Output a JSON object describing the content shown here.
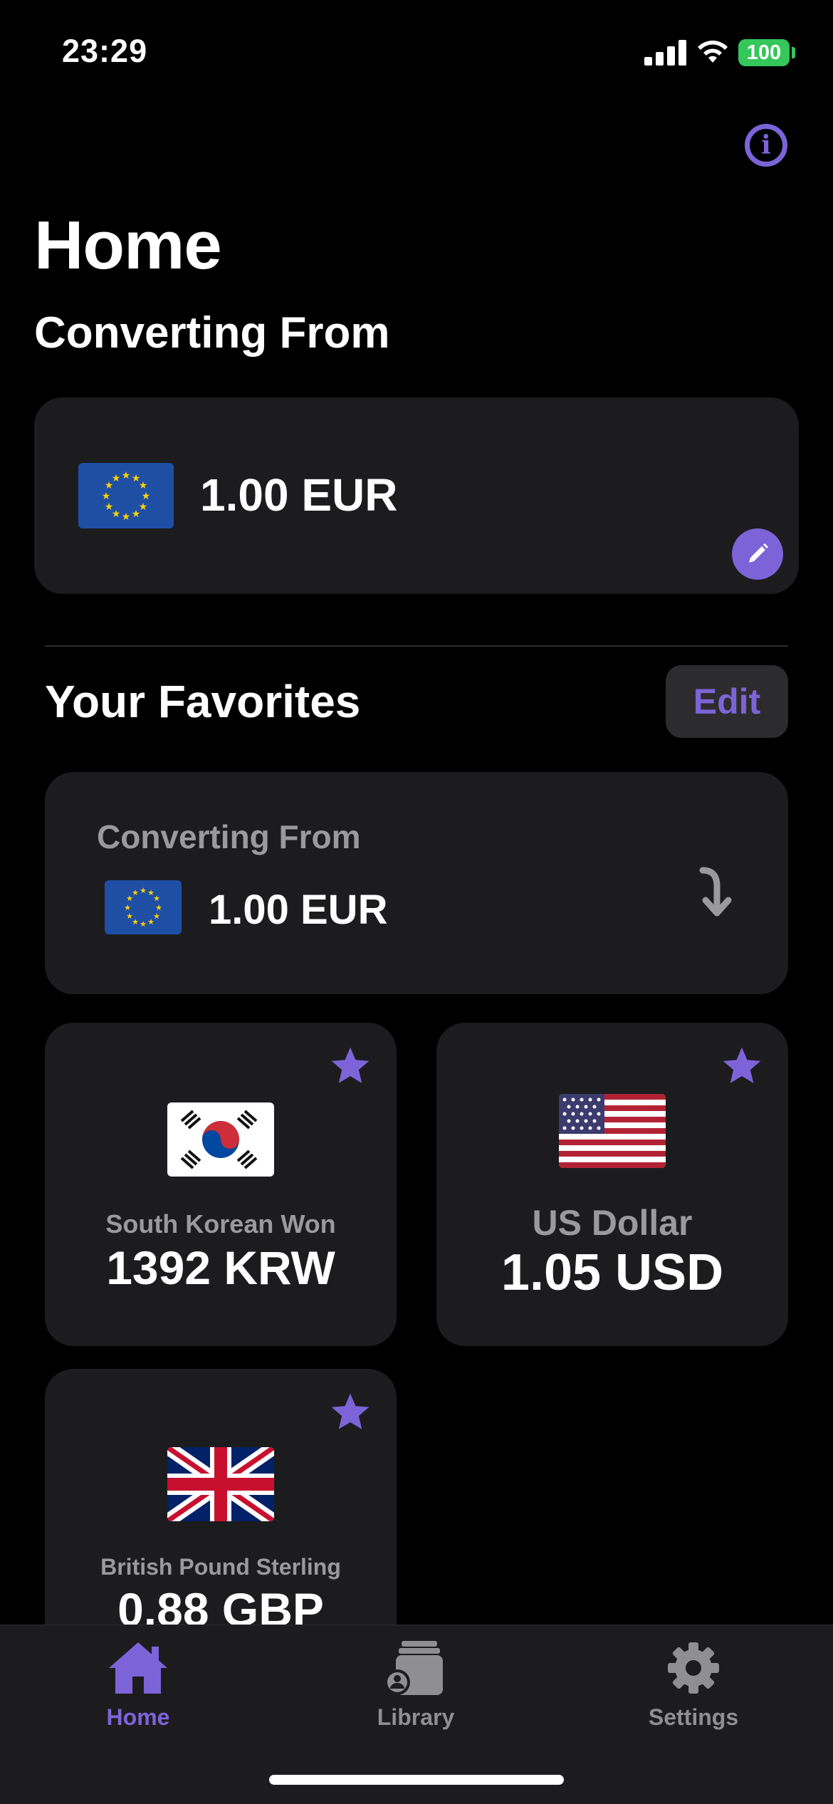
{
  "status_bar": {
    "time": "23:29",
    "battery": "100",
    "icons": [
      "signal-icon",
      "wifi-icon",
      "battery-icon"
    ]
  },
  "header": {
    "info_icon": "info-icon",
    "title": "Home"
  },
  "converting_from": {
    "heading": "Converting From",
    "amount": "1.00 EUR",
    "flag": "eu-flag-icon",
    "edit_icon": "pencil-icon"
  },
  "favorites": {
    "heading": "Your Favorites",
    "edit_label": "Edit",
    "from_card": {
      "label": "Converting From",
      "amount": "1.00 EUR",
      "flag": "eu-flag-icon",
      "icon": "arrow-turn-down-icon"
    },
    "items": [
      {
        "name": "South Korean Won",
        "value": "1392 KRW",
        "flag": "south-korea-flag-icon",
        "favorite": true
      },
      {
        "name": "US Dollar",
        "value": "1.05 USD",
        "flag": "us-flag-icon",
        "favorite": true
      },
      {
        "name": "British Pound Sterling",
        "value": "0.88 GBP",
        "flag": "uk-flag-icon",
        "favorite": true
      }
    ]
  },
  "tab_bar": {
    "tabs": [
      {
        "label": "Home",
        "icon": "house-icon",
        "active": true
      },
      {
        "label": "Library",
        "icon": "library-icon",
        "active": false
      },
      {
        "label": "Settings",
        "icon": "gear-icon",
        "active": false
      }
    ]
  },
  "colors": {
    "accent": "#7c64d8",
    "background": "#000000",
    "card": "#1c1c1e",
    "secondary_text": "#9a9a9e",
    "battery": "#34c759"
  }
}
